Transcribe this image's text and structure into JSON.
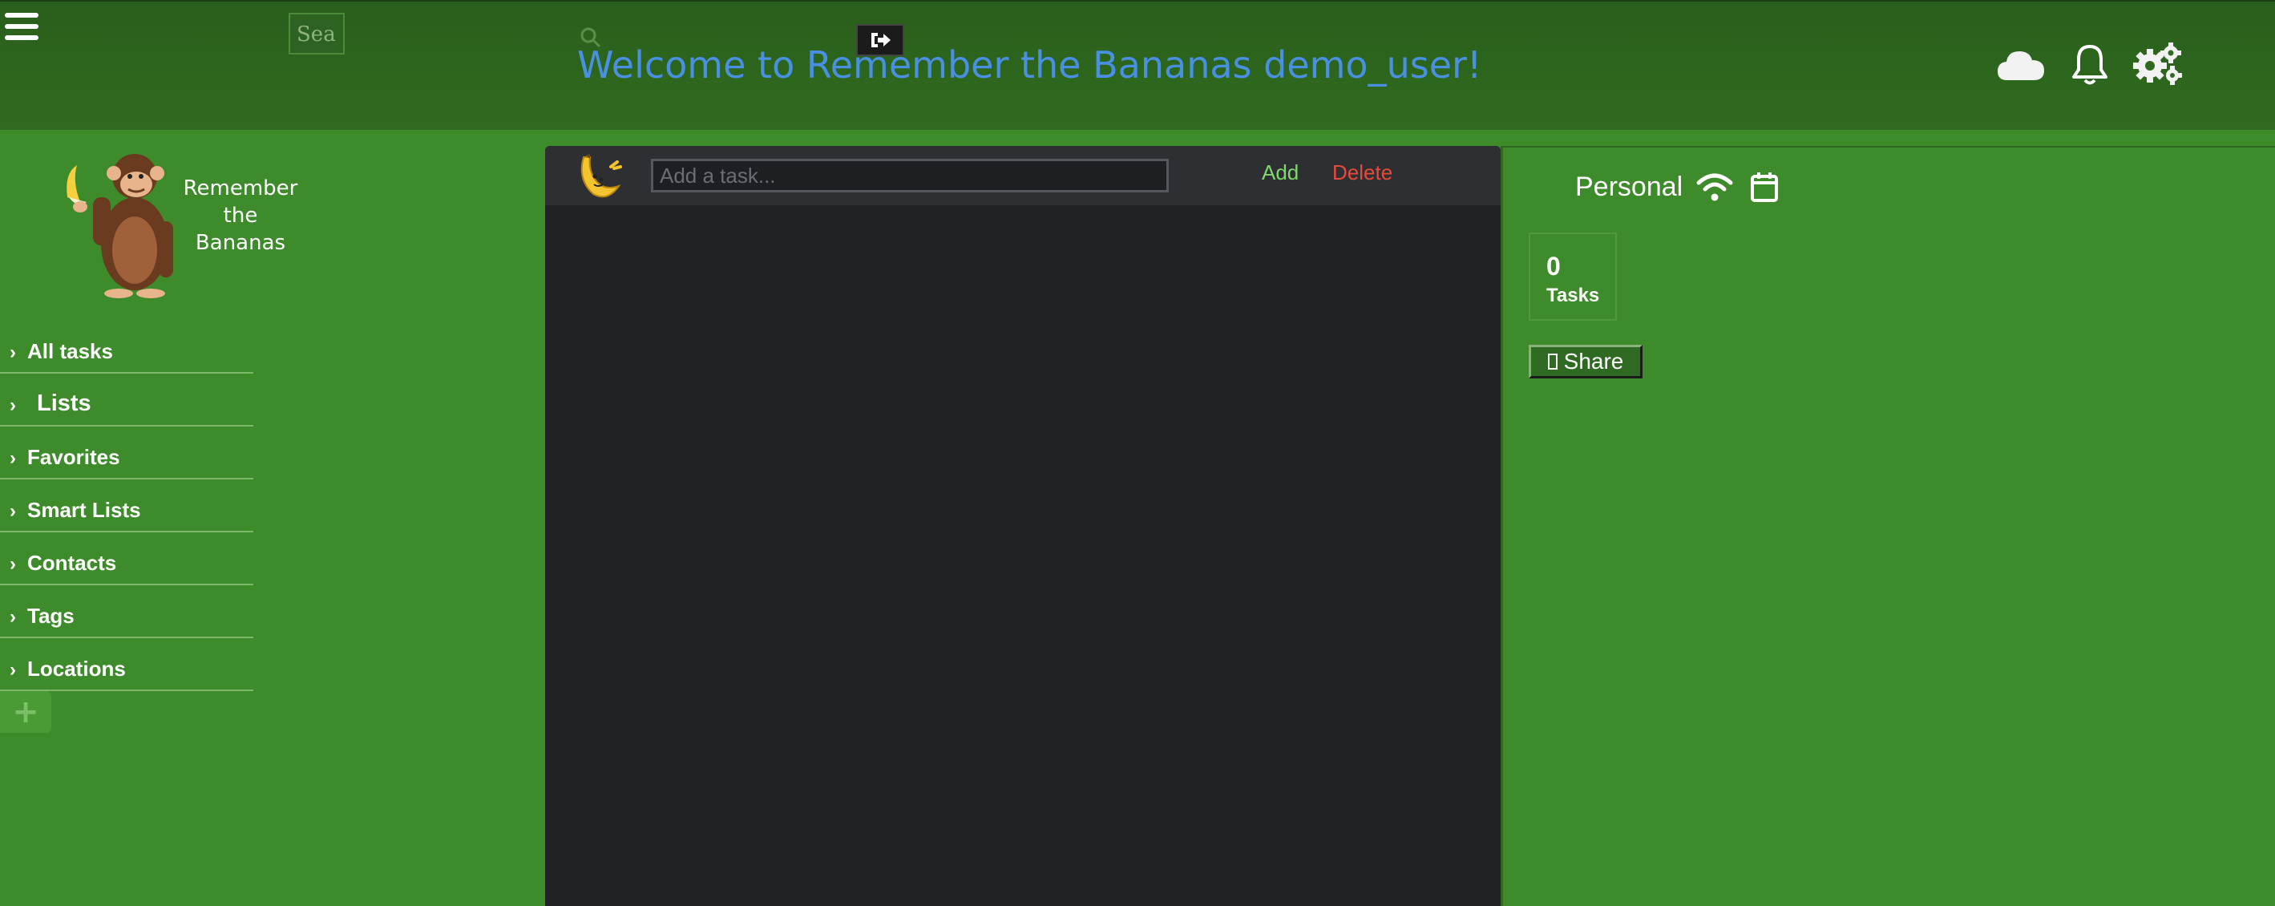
{
  "header": {
    "welcome_text": "Welcome to Remember the Bananas demo_user!",
    "search_placeholder": "Search",
    "search_visible_text": "Sea",
    "icons": [
      "menu-icon",
      "search-icon",
      "logout-icon",
      "cloud-icon",
      "bell-icon",
      "gears-icon"
    ]
  },
  "logo": {
    "text": [
      "Remember",
      "the",
      "Bananas"
    ]
  },
  "sidebar": {
    "items": [
      {
        "label": "All tasks"
      },
      {
        "label": "Lists"
      },
      {
        "label": "Favorites"
      },
      {
        "label": "Smart Lists"
      },
      {
        "label": "Contacts"
      },
      {
        "label": "Tags"
      },
      {
        "label": "Locations"
      }
    ],
    "add_label": "+"
  },
  "task_bar": {
    "input_placeholder": "Add a task...",
    "input_value": "",
    "add_label": "Add",
    "delete_label": "Delete"
  },
  "right_panel": {
    "list_name": "Personal",
    "stat_count": "0",
    "stat_label": "Tasks",
    "share_label": "Share"
  },
  "colors": {
    "page_green": "#3d8b2a",
    "header_green": "#2f6b1e",
    "panel_dark": "#202124",
    "welcome_blue": "#4a90e2",
    "add_green": "#7ed96a",
    "delete_red": "#e84a3a"
  }
}
